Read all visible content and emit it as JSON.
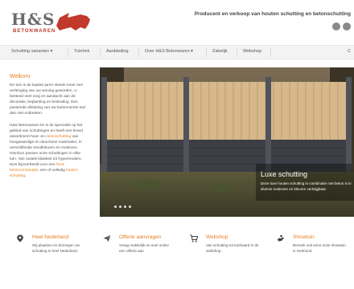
{
  "header": {
    "logo_text": "H&S",
    "logo_sub": "BETONWAREN",
    "tagline": "Producent en verkoop van houten schutting en betonschutting"
  },
  "nav": {
    "items": [
      {
        "label": "Schutting varianten ▾"
      },
      {
        "label": "Tuinhek"
      },
      {
        "label": "Aanbieding"
      },
      {
        "label": "Over H&S Betonwaren ▾"
      },
      {
        "label": "Zakelijk"
      },
      {
        "label": "Webshop"
      }
    ],
    "trailing": "C"
  },
  "sidebar": {
    "title": "Welkom",
    "p1": "De tuin is de laatste jaren steeds meer een verlenging van uw woning geworden. U besteed veel zorg en aandacht aan de decoratie, beplanting en bestrating. Een passende afsluiting van uw buitenruimte kan dan niet ontbreken.",
    "p2_a": "H&S Betonwaren bv is de specialist op het gebied van schuttingen en heeft een breed assortiment hout- en ",
    "p2_link1": "betonschutting",
    "p2_b": " van hoogwaardige en duurzame materialen, in verschillende trendkleuren en motieven. Hierdoor passen onze schuttingen in elke tuin. Van rustiek klassiek tot hypermodern. Kies bijvoorbeeld voor een ",
    "p2_link2": "hout-betoncombinatie",
    "p2_c": ", een of volledig ",
    "p2_link3": "houten schutting",
    "p2_d": "."
  },
  "hero": {
    "title": "Luxe schutting",
    "text": "Deze luxe houten schutting in combinatie met beton is in diverse motieven en kleuren verkrijgbaar.",
    "slide_count": 4
  },
  "features": [
    {
      "icon": "map-marker-icon",
      "title": "Heel Nederland",
      "text": "Wij plaatsen en bezorgen uw schutting in heel Nederland."
    },
    {
      "icon": "paper-plane-icon",
      "title": "Offerte aanvragen",
      "text": "Vraag makkelijk en snel online een offerte aan"
    },
    {
      "icon": "cart-icon",
      "title": "Webshop",
      "text": "Van schutting tot tuinhaard in de webshop."
    },
    {
      "icon": "hand-icon",
      "title": "Showtuin",
      "text": "Bezoek ook eens onze showtuin in Helmond."
    }
  ],
  "colors": {
    "accent": "#e67e22",
    "logo_red": "#c0392b"
  }
}
